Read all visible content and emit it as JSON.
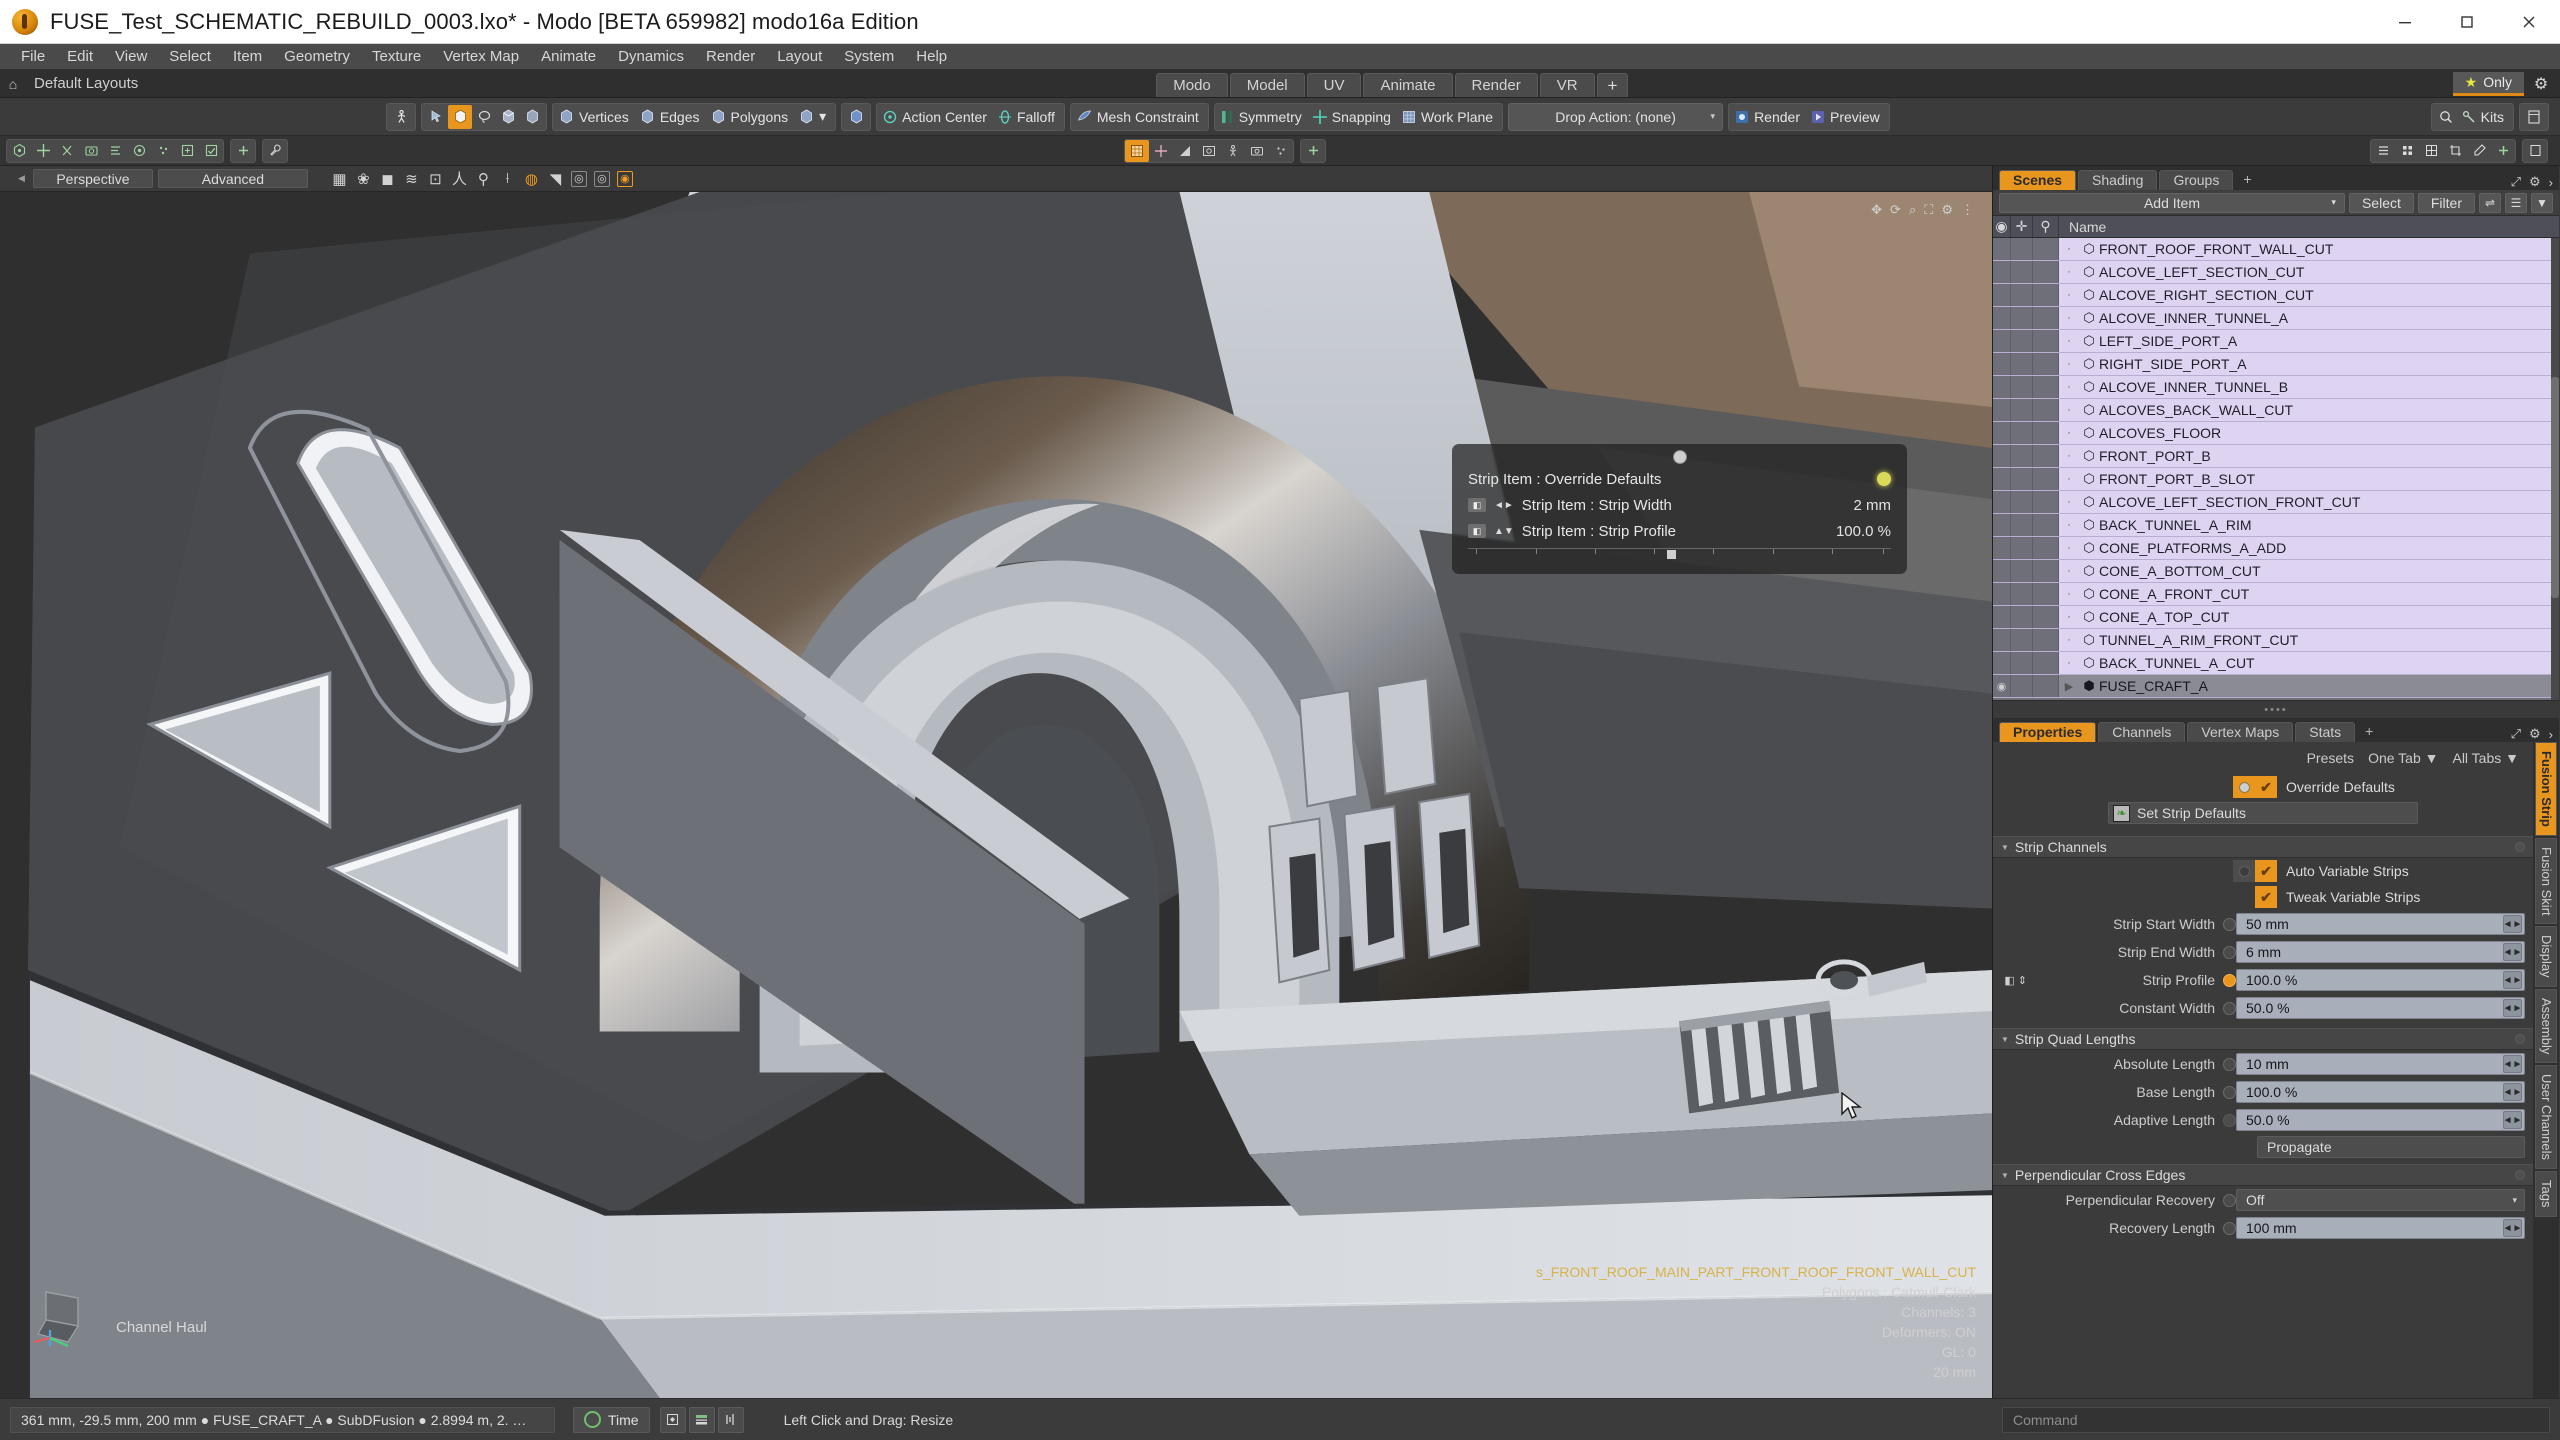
{
  "window": {
    "title": "FUSE_Test_SCHEMATIC_REBUILD_0003.lxo* - Modo [BETA 659982]   modo16a Edition",
    "minimize": "—",
    "maximize": "▢",
    "close": "✕"
  },
  "menubar": [
    "File",
    "Edit",
    "View",
    "Select",
    "Item",
    "Geometry",
    "Texture",
    "Vertex Map",
    "Animate",
    "Dynamics",
    "Render",
    "Layout",
    "System",
    "Help"
  ],
  "layout_row": {
    "home_icon": "home-icon",
    "name": "Default Layouts",
    "tabs": [
      {
        "label": "Modo",
        "active": false
      },
      {
        "label": "Model",
        "active": false
      },
      {
        "label": "UV",
        "active": false
      },
      {
        "label": "Animate",
        "active": false
      },
      {
        "label": "Render",
        "active": false
      },
      {
        "label": "VR",
        "active": false
      },
      {
        "label": "+",
        "active": false
      }
    ],
    "only_label": "Only",
    "only_star": "★",
    "gear": "⚙"
  },
  "toolbar": {
    "left_icons": [
      "person-icon",
      "cursor-icon",
      "vertex-select-icon",
      "lasso-icon",
      "edge-select-icon",
      "polygon-select-icon"
    ],
    "mode_buttons": [
      {
        "label": "Vertices",
        "icon": "vertices-icon"
      },
      {
        "label": "Edges",
        "icon": "edges-icon"
      },
      {
        "label": "Polygons",
        "icon": "polygons-icon"
      },
      {
        "label": "",
        "icon": "materials-icon"
      }
    ],
    "action_center": "Action Center",
    "falloff": "Falloff",
    "mesh_constraint": "Mesh Constraint",
    "symmetry": "Symmetry",
    "snapping": "Snapping",
    "work_plane": "Work Plane",
    "drop_action": "Drop Action: (none)",
    "render": "Render",
    "preview": "Preview",
    "kits": "Kits",
    "search_icon": "search-icon",
    "panel_icon": "panel-icon"
  },
  "viewport": {
    "view_mode": "Perspective",
    "shading_mode": "Advanced",
    "header_icons": [
      "checker-icon",
      "wireframe-icon",
      "shaded-icon",
      "texture-icon",
      "camera-frame-icon",
      "person-icon",
      "pivot-icon",
      "paint-icon",
      "bake-icon",
      "gradient-icon",
      "box-a-icon",
      "box-b-icon",
      "box-c-icon"
    ],
    "nav_icons": [
      "pan-icon",
      "rotate-icon",
      "zoom-icon",
      "fit-icon",
      "settings-icon",
      "options-icon"
    ],
    "channel_haul_label": "Channel Haul",
    "axis_gizmo": "axis-gizmo",
    "info": {
      "mesh_name": "s_FRONT_ROOF_MAIN_PART_FRONT_ROOF_FRONT_WALL_CUT",
      "polygons": "Polygons : Catmull-Clark",
      "channels": "Channels: 3",
      "deformers": "Deformers: ON",
      "gl": "GL: 0",
      "scale": "20 mm"
    },
    "hud": {
      "title": "Strip Item : Override Defaults",
      "rows": [
        {
          "label": "Strip Item : Strip Width",
          "value": "2 mm",
          "icon": "width-arrows-icon"
        },
        {
          "label": "Strip Item : Strip Profile",
          "value": "100.0 %",
          "icon": "profile-arrows-icon"
        }
      ]
    }
  },
  "items_panel": {
    "tabs": [
      {
        "label": "Scenes",
        "active": true
      },
      {
        "label": "Shading",
        "active": false
      },
      {
        "label": "Groups",
        "active": false
      },
      {
        "label": "+",
        "active": false
      }
    ],
    "tab_right_icons": [
      "expand-icon",
      "gear-icon",
      "chevron-right-icon"
    ],
    "add_item": "Add Item",
    "select": "Select",
    "filter": "Filter",
    "sq_icons": [
      "list-options-icon",
      "list-view-icon",
      "funnel-icon"
    ],
    "columns": [
      "eye-icon",
      "plus-icon",
      "lock-icon",
      "Name"
    ],
    "rows": [
      {
        "name": "FRONT_ROOF_FRONT_WALL_CUT",
        "selected": true
      },
      {
        "name": "ALCOVE_LEFT_SECTION_CUT",
        "selected": true
      },
      {
        "name": "ALCOVE_RIGHT_SECTION_CUT",
        "selected": true
      },
      {
        "name": "ALCOVE_INNER_TUNNEL_A",
        "selected": true
      },
      {
        "name": "LEFT_SIDE_PORT_A",
        "selected": true
      },
      {
        "name": "RIGHT_SIDE_PORT_A",
        "selected": true
      },
      {
        "name": "ALCOVE_INNER_TUNNEL_B",
        "selected": true
      },
      {
        "name": "ALCOVES_BACK_WALL_CUT",
        "selected": true
      },
      {
        "name": "ALCOVES_FLOOR",
        "selected": true
      },
      {
        "name": "FRONT_PORT_B",
        "selected": true
      },
      {
        "name": "FRONT_PORT_B_SLOT",
        "selected": true
      },
      {
        "name": "ALCOVE_LEFT_SECTION_FRONT_CUT",
        "selected": true
      },
      {
        "name": "BACK_TUNNEL_A_RIM",
        "selected": true
      },
      {
        "name": "CONE_PLATFORMS_A_ADD",
        "selected": true
      },
      {
        "name": "CONE_A_BOTTOM_CUT",
        "selected": true
      },
      {
        "name": "CONE_A_FRONT_CUT",
        "selected": true
      },
      {
        "name": "CONE_A_TOP_CUT",
        "selected": true
      },
      {
        "name": "TUNNEL_A_RIM_FRONT_CUT",
        "selected": true
      },
      {
        "name": "BACK_TUNNEL_A_CUT",
        "selected": true
      }
    ],
    "root_row": {
      "name": "FUSE_CRAFT_A"
    }
  },
  "properties_panel": {
    "tabs": [
      {
        "label": "Properties",
        "active": true
      },
      {
        "label": "Channels",
        "active": false
      },
      {
        "label": "Vertex Maps",
        "active": false
      },
      {
        "label": "Stats",
        "active": false
      },
      {
        "label": "+",
        "active": false
      }
    ],
    "tab_right_icons": [
      "expand-icon",
      "gear-icon",
      "chevron-right-icon"
    ],
    "presets_row": [
      "Presets",
      "One Tab ▼",
      "All Tabs ▼"
    ],
    "override_defaults": "Override Defaults",
    "set_strip_defaults": "Set Strip Defaults",
    "sections": [
      {
        "title": "Strip Channels",
        "checks": [
          {
            "label": "Auto Variable Strips",
            "checked": true,
            "radio": false
          },
          {
            "label": "Tweak Variable Strips",
            "checked": true,
            "radio": false
          }
        ],
        "fields": [
          {
            "label": "Strip Start Width",
            "value": "50 mm",
            "type": "input",
            "dot": "off"
          },
          {
            "label": "Strip End Width",
            "value": "6 mm",
            "type": "input",
            "dot": "off"
          },
          {
            "label": "Strip Profile",
            "value": "100.0 %",
            "type": "input",
            "dot": "on"
          },
          {
            "label": "Constant Width",
            "value": "50.0 %",
            "type": "input",
            "dot": "off"
          }
        ]
      },
      {
        "title": "Strip Quad Lengths",
        "checks": [],
        "fields": [
          {
            "label": "Absolute Length",
            "value": "10 mm",
            "type": "input",
            "dot": "off"
          },
          {
            "label": "Base Length",
            "value": "100.0 %",
            "type": "input",
            "dot": "off"
          },
          {
            "label": "Adaptive Length",
            "value": "50.0 %",
            "type": "input",
            "dot": "none"
          }
        ],
        "button": "Propagate"
      },
      {
        "title": "Perpendicular Cross Edges",
        "checks": [],
        "fields": [
          {
            "label": "Perpendicular Recovery",
            "value": "Off",
            "type": "select",
            "dot": "off"
          },
          {
            "label": "Recovery Length",
            "value": "100 mm",
            "type": "input",
            "dot": "off"
          }
        ]
      }
    ],
    "vertical_tabs": [
      {
        "label": "Fusion Strip",
        "active": true
      },
      {
        "label": "Fusion Skirt",
        "active": false
      },
      {
        "label": "Display",
        "active": false
      },
      {
        "label": "Assembly",
        "active": false
      },
      {
        "label": "User Channels",
        "active": false
      },
      {
        "label": "Tags",
        "active": false
      }
    ]
  },
  "bottom_bar": {
    "status": "361 mm, -29.5 mm, 200 mm ● FUSE_CRAFT_A ● SubDFusion ● 2.8994 m, 2. …",
    "time_label": "Time",
    "time_icon": "clock-icon",
    "buttons": [
      "keyframe-icon",
      "graph-icon",
      "audio-icon"
    ],
    "hint": "Left Click and Drag:  Resize",
    "command_placeholder": "Command"
  }
}
